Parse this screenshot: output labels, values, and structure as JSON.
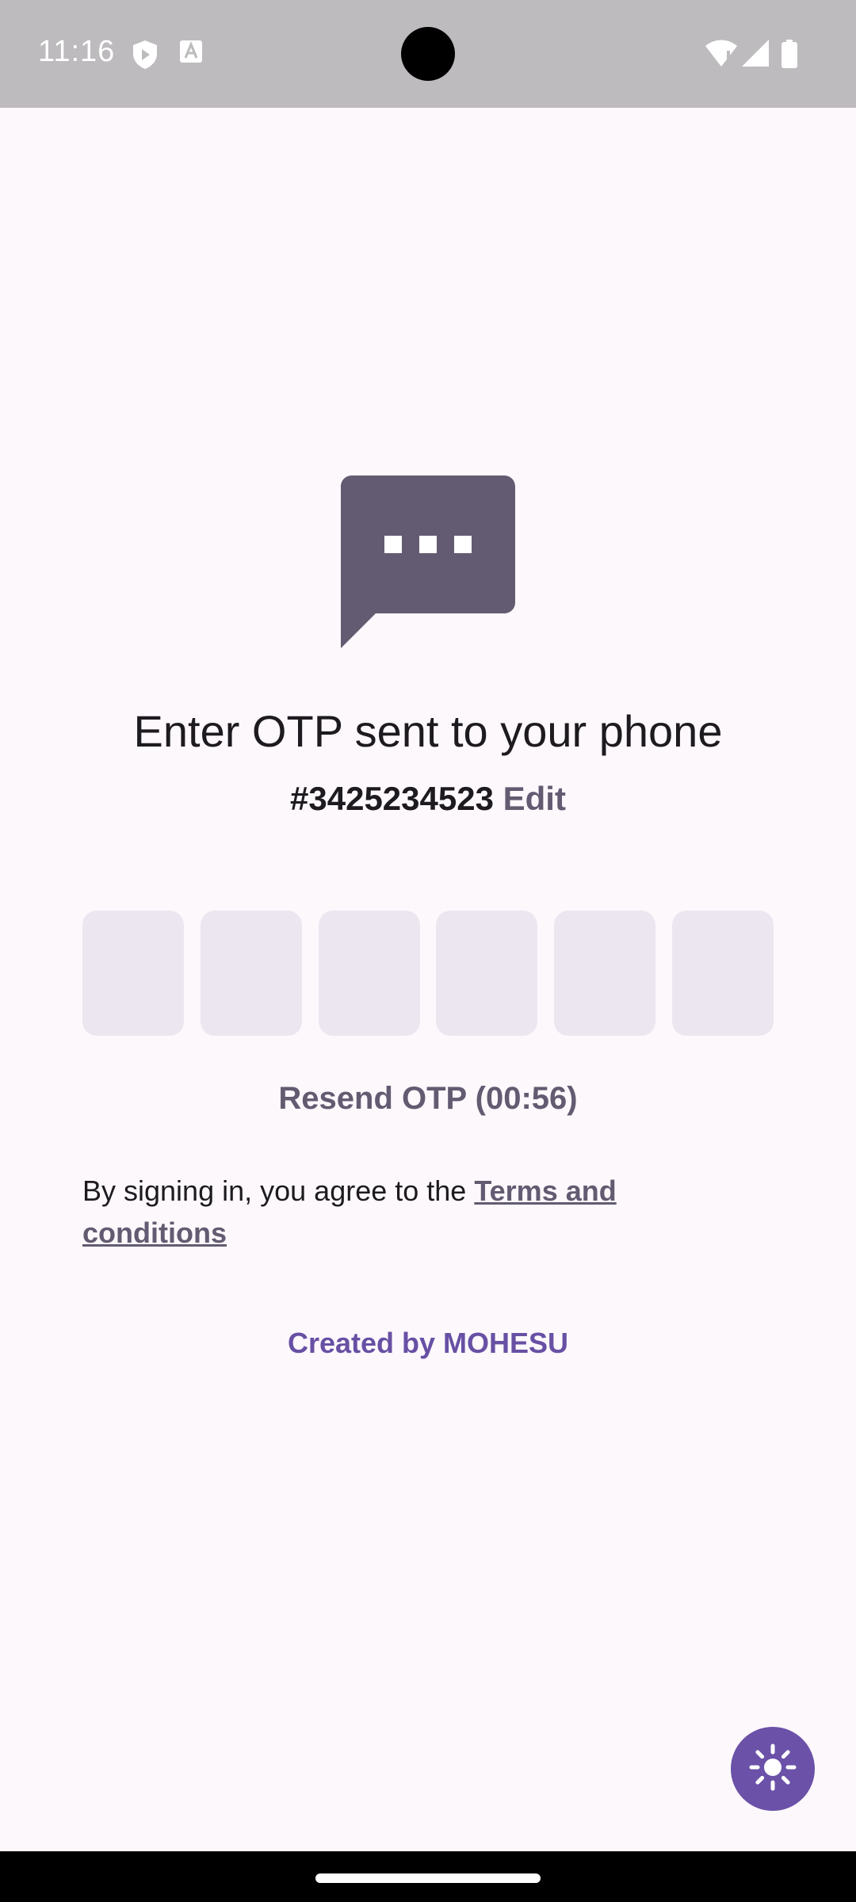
{
  "status_bar": {
    "time": "11:16",
    "icons": [
      "shield-icon",
      "font-icon",
      "wifi-alert-icon",
      "signal-icon",
      "battery-icon"
    ]
  },
  "otp": {
    "header_icon": "chat-bubble-icon",
    "title": "Enter OTP sent to your phone",
    "phone_number": "#3425234523",
    "edit_label": "Edit",
    "digits": [
      "",
      "",
      "",
      "",
      "",
      ""
    ],
    "resend_label": "Resend OTP (00:56)"
  },
  "terms": {
    "prefix": "By signing in, you agree to the ",
    "link_label": "Terms and conditions"
  },
  "footer": {
    "credit": "Created by MOHESU"
  },
  "theme_toggle": {
    "icon": "sun-icon"
  },
  "colors": {
    "accent": "#6750a4",
    "icon_fill": "#625b71",
    "otp_box": "#ece6f0",
    "background": "#fdf8fc",
    "status_bar": "#bdbbbd"
  }
}
